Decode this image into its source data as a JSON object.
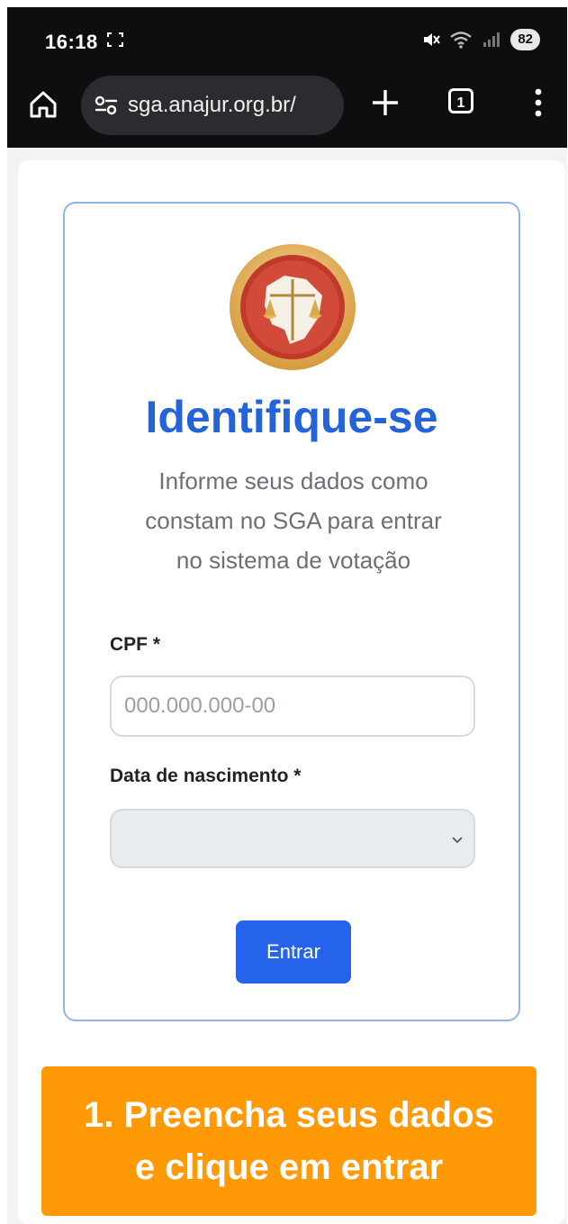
{
  "status_bar": {
    "time": "16:18",
    "battery": "82"
  },
  "browser": {
    "url": "sga.anajur.org.br/",
    "tab_count": "1"
  },
  "login": {
    "title": "Identifique-se",
    "subtitle_lines": [
      "Informe seus dados como",
      "constam no SGA para entrar",
      "no sistema de votação"
    ],
    "cpf_label": "CPF *",
    "cpf_placeholder": "000.000.000-00",
    "dob_label": "Data de nascimento *",
    "dob_value": "",
    "submit_label": "Entrar"
  },
  "banner": {
    "lines": [
      "1. Preencha seus dados",
      "e clique em entrar"
    ]
  },
  "icons": {
    "home": "home-icon",
    "site_settings": "tune-icon",
    "new_tab": "plus-icon",
    "menu": "more-vert-icon",
    "select": "chevron-down-icon"
  },
  "colors": {
    "title": "#2563d9",
    "button": "#2563eb",
    "banner": "#ff9a06",
    "card_border": "#8fb6e8"
  }
}
